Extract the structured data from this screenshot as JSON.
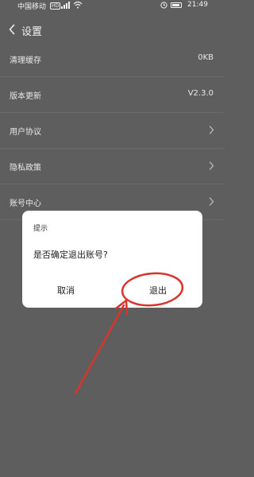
{
  "status_bar": {
    "carrier": "中国移动",
    "network_badge": "HD",
    "time": "21:49",
    "icons": [
      "signal-icon",
      "wifi-icon",
      "alarm-icon",
      "battery-icon"
    ]
  },
  "header": {
    "title": "设置",
    "back_icon": "chevron-left-icon"
  },
  "settings": {
    "items": [
      {
        "label": "清理缓存",
        "value": "0KB"
      },
      {
        "label": "版本更新",
        "value": "V2.3.0"
      },
      {
        "label": "用户协议",
        "icon": "chevron-right-icon"
      },
      {
        "label": "隐私政策",
        "icon": "chevron-right-icon"
      },
      {
        "label": "账号中心",
        "icon": "chevron-right-icon"
      }
    ]
  },
  "dialog": {
    "title": "提示",
    "message": "是否确定退出账号?",
    "cancel_label": "取消",
    "confirm_label": "退出"
  },
  "colors": {
    "overlay": "#5e5e5e",
    "dialog_bg": "#ffffff",
    "annotation_red": "#d9342b"
  }
}
